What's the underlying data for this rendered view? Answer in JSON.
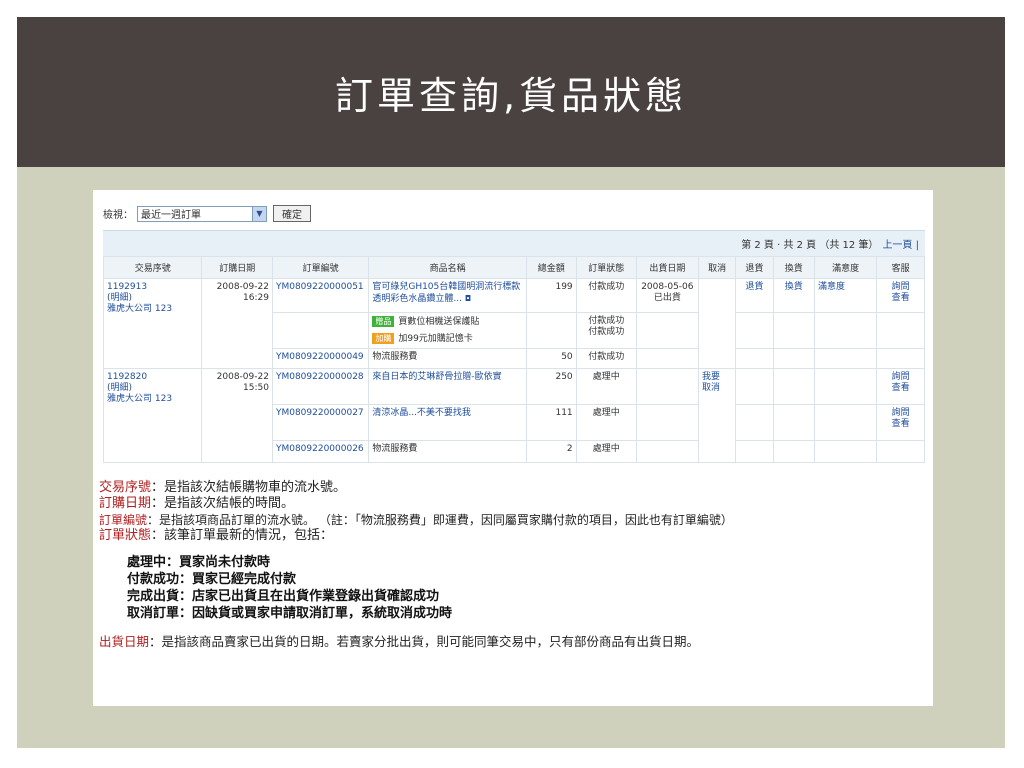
{
  "slide": {
    "title": "訂單查詢,貨品狀態"
  },
  "filter": {
    "label": "檢視：",
    "selected": "最近一週訂單",
    "confirm_label": "確定"
  },
  "pager": {
    "text": "第 2 頁 ‧ 共 2 頁 （共 12 筆）",
    "prev_link": "上一頁 |"
  },
  "table": {
    "headers": [
      "交易序號",
      "訂購日期",
      "訂單編號",
      "商品名稱",
      "總金額",
      "訂單狀態",
      "出貨日期",
      "取消",
      "退貨",
      "換貨",
      "滿意度",
      "客服"
    ],
    "orders": [
      {
        "txn_id": "1192913",
        "txn_detail": "(明細)",
        "shop": "雅虎大公司 123",
        "date": "2008-09-22",
        "time": "16:29",
        "rows": [
          {
            "order_no": "YM0809220000051",
            "product": "官可綠兒GH105台韓國明洞流行標款透明彩色水晶鑽立體...",
            "amount": "199",
            "status": "付款成功",
            "ship_date": "2008-05-06",
            "ship_status": "已出貨",
            "return": "退貨",
            "exchange": "換貨",
            "satisfaction": "滿意度",
            "service_1": "詢問",
            "service_2": "查看"
          },
          {
            "tag_1": "贈品",
            "gift_1": "買數位相機送保護貼",
            "tag_2": "加購",
            "gift_2": "加99元加購記憶卡",
            "status_1": "付款成功",
            "status_2": "付款成功"
          },
          {
            "order_no": "YM0809220000049",
            "product": "物流服務費",
            "amount": "50",
            "status": "付款成功"
          }
        ]
      },
      {
        "txn_id": "1192820",
        "txn_detail": "(明細)",
        "shop": "雅虎大公司 123",
        "date": "2008-09-22",
        "time": "15:50",
        "cancel_1": "我要",
        "cancel_2": "取消",
        "rows": [
          {
            "order_no": "YM0809220000028",
            "product": "來自日本的艾琳舒骨拉贈-歐依實",
            "amount": "250",
            "status": "處理中",
            "service_1": "詢問",
            "service_2": "查看"
          },
          {
            "order_no": "YM0809220000027",
            "product": "清涼冰晶...不美不要找我",
            "amount": "111",
            "status": "處理中",
            "service_1": "詢問",
            "service_2": "查看"
          },
          {
            "order_no": "YM0809220000026",
            "product": "物流服務費",
            "amount": "2",
            "status": "處理中"
          }
        ]
      }
    ]
  },
  "notes": {
    "defs": [
      {
        "term": "交易序號",
        "text": "：是指該次結帳購物車的流水號。"
      },
      {
        "term": "訂購日期",
        "text": "：是指該次結帳的時間。"
      },
      {
        "term": "訂單編號",
        "text": "：是指該項商品訂單的流水號。 （註：「物流服務費」即運費，因同屬買家購付款的項目，因此也有訂單編號）"
      },
      {
        "term": "訂單狀態",
        "text": "：該筆訂單最新的情況，包括："
      }
    ],
    "statuses": [
      "處理中：買家尚未付款時",
      "付款成功：買家已經完成付款",
      "完成出貨：店家已出貨且在出貨作業登錄出貨確認成功",
      "取消訂單：因缺貨或買家申請取消訂單，系統取消成功時"
    ],
    "ship": {
      "term": "出貨日期",
      "text": "：是指該商品賣家已出貨的日期。若賣家分批出貨，則可能同筆交易中，只有部份商品有出貨日期。"
    }
  }
}
